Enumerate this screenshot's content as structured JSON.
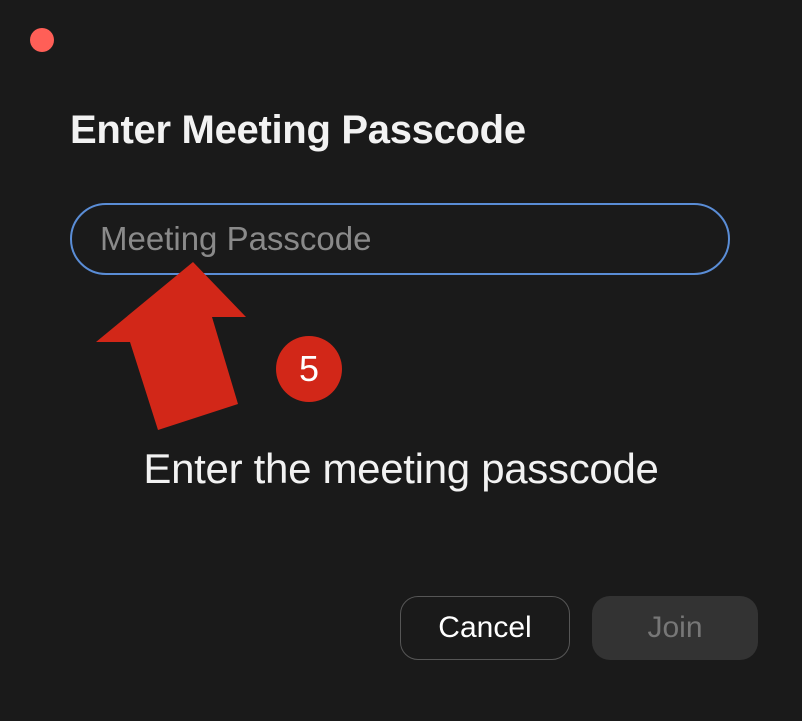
{
  "dialog": {
    "title": "Enter Meeting Passcode",
    "passcode_placeholder": "Meeting Passcode",
    "passcode_value": ""
  },
  "annotation": {
    "step_number": "5",
    "instruction": "Enter the meeting passcode",
    "colors": {
      "accent": "#d22718"
    }
  },
  "buttons": {
    "cancel_label": "Cancel",
    "join_label": "Join"
  }
}
